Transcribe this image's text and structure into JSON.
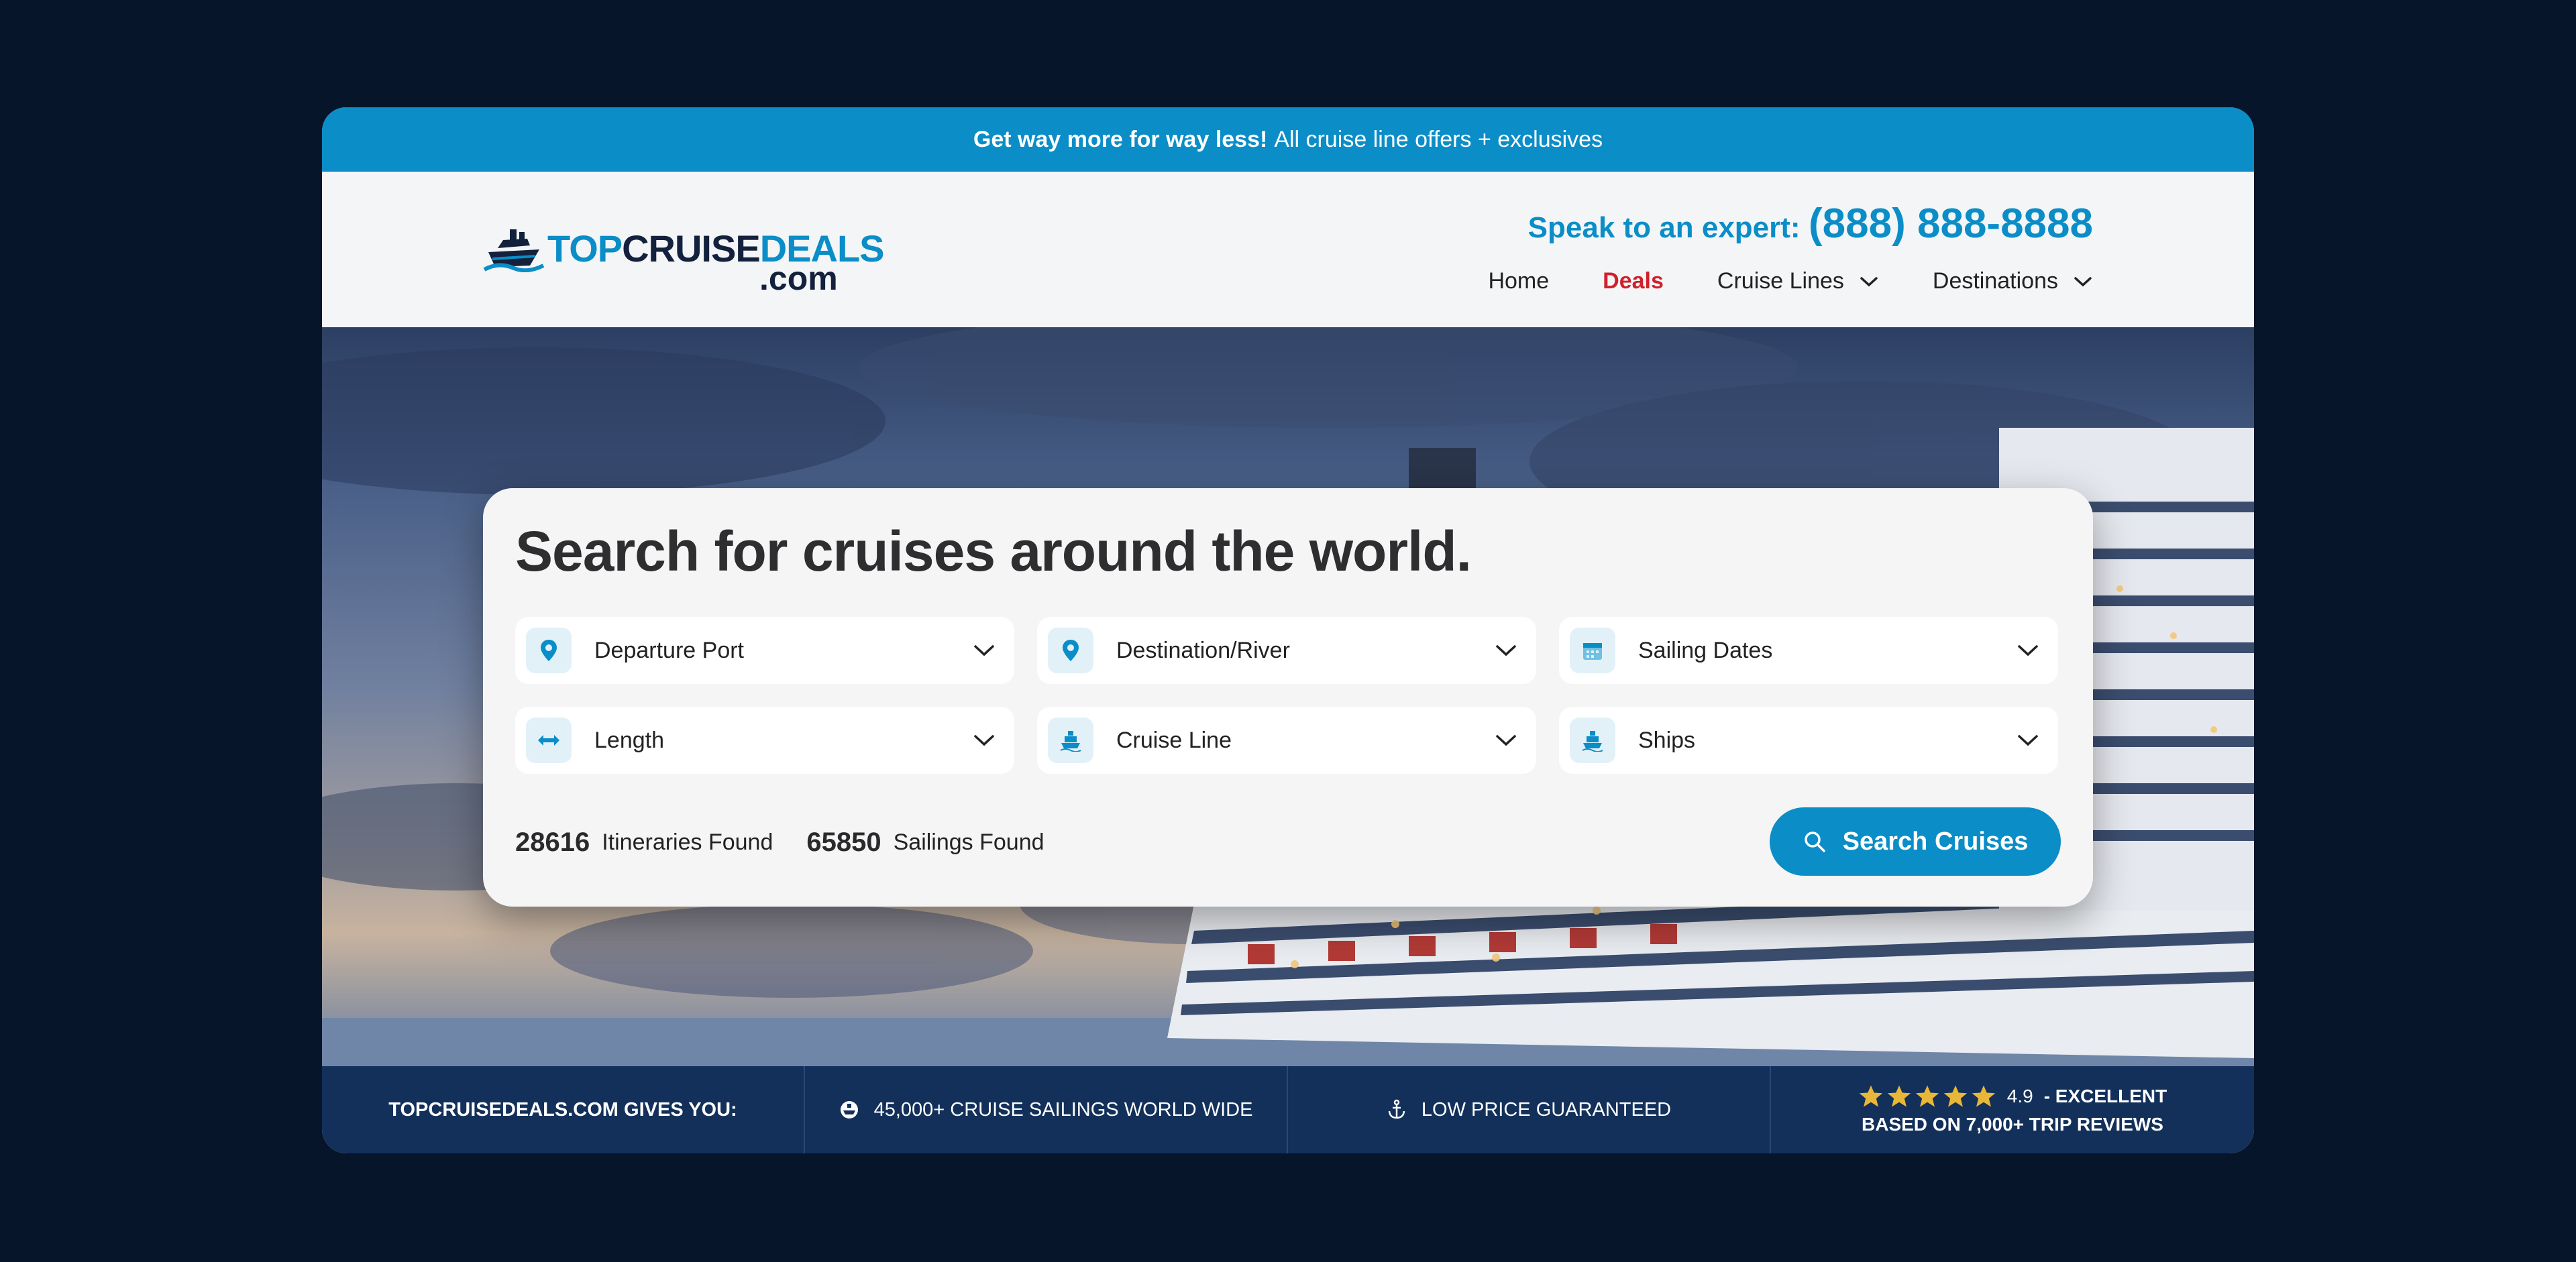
{
  "promo": {
    "bold": "Get way more for way less!",
    "text": "All cruise line offers + exclusives"
  },
  "brand": {
    "top": "TOP",
    "cruise": "CRUISE",
    "deals": "DEALS",
    "com": ".com"
  },
  "contact": {
    "label": "Speak to an expert:",
    "phone": "(888) 888-8888"
  },
  "nav": [
    {
      "label": "Home",
      "active": false,
      "dropdown": false
    },
    {
      "label": "Deals",
      "active": true,
      "dropdown": false
    },
    {
      "label": "Cruise Lines",
      "active": false,
      "dropdown": true
    },
    {
      "label": "Destinations",
      "active": false,
      "dropdown": true
    }
  ],
  "search": {
    "heading": "Search for cruises around the world.",
    "fields": [
      {
        "label": "Departure Port",
        "icon": "location-pin-icon"
      },
      {
        "label": "Destination/River",
        "icon": "location-pin-icon"
      },
      {
        "label": "Sailing Dates",
        "icon": "calendar-icon"
      },
      {
        "label": "Length",
        "icon": "double-arrow-icon"
      },
      {
        "label": "Cruise Line",
        "icon": "ship-icon"
      },
      {
        "label": "Ships",
        "icon": "ship-icon"
      }
    ],
    "itineraries_count": "28616",
    "itineraries_label": "Itineraries Found",
    "sailings_count": "65850",
    "sailings_label": "Sailings Found",
    "button_label": "Search Cruises"
  },
  "footer": {
    "gives_you": "TOPCRUISEDEALS.COM GIVES YOU:",
    "sailings": "45,000+ CRUISE SAILINGS WORLD WIDE",
    "price": "LOW PRICE GUARANTEED",
    "score": "4.9",
    "rating_word": "- EXCELLENT",
    "reviews": "BASED ON 7,000+ TRIP REVIEWS",
    "stars": 5
  },
  "colors": {
    "brand_blue": "#0b8ec7",
    "navy": "#12305a",
    "active_red": "#d0202a",
    "star": "#e8b73a"
  }
}
